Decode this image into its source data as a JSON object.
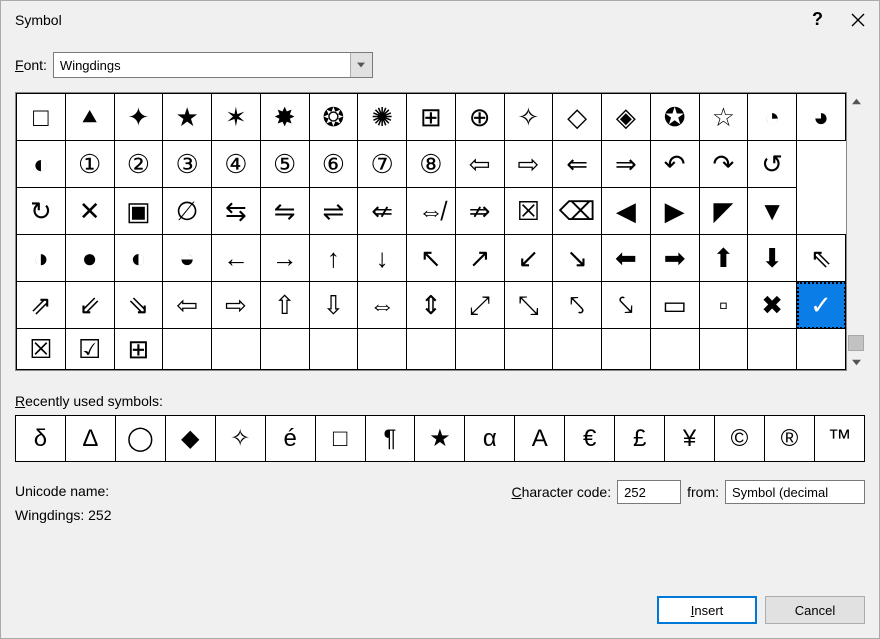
{
  "dialog": {
    "title": "Symbol"
  },
  "font": {
    "label_prefix": "F",
    "label_rest": "ont:",
    "value": "Wingdings"
  },
  "grid": {
    "rows": [
      [
        "□",
        "⯅",
        "✦",
        "★",
        "✶",
        "✸",
        "❂",
        "✺",
        "⊞",
        "⊕",
        "✧",
        "◇",
        "◈",
        "✪",
        "☆",
        "◔",
        "◕"
      ],
      [
        "◐",
        "①",
        "②",
        "③",
        "④",
        "⑤",
        "⑥",
        "⑦",
        "⑧",
        "⇦",
        "⇨",
        "⇐",
        "⇒",
        "↶",
        "↷",
        "↺"
      ],
      [
        "↻",
        "✕",
        "▣",
        "∅",
        "⇆",
        "⇋",
        "⇌",
        "⇍",
        "⇎",
        "⇏",
        "☒",
        "⌫",
        "◀",
        "▶",
        "◤",
        "▼"
      ],
      [
        "◑",
        "●",
        "◐",
        "◒",
        "←",
        "→",
        "↑",
        "↓",
        "↖",
        "↗",
        "↙",
        "↘",
        "⬅",
        "➡",
        "⬆",
        "⬇",
        "⇖"
      ],
      [
        "⇗",
        "⇙",
        "⇘",
        "⇦",
        "⇨",
        "⇧",
        "⇩",
        "⇔",
        "⇕",
        "⤢",
        "⤡",
        "⤣",
        "⤥",
        "▭",
        "▫",
        "✖",
        "✓"
      ],
      [
        "☒",
        "☑",
        "⊞",
        "",
        "",
        "",
        "",
        "",
        "",
        "",
        "",
        "",
        "",
        "",
        "",
        "",
        ""
      ]
    ],
    "selected": {
      "row": 4,
      "col": 16
    }
  },
  "recent": {
    "label_prefix": "R",
    "label_rest": "ecently used symbols:",
    "items": [
      "δ",
      "Δ",
      "◯",
      "◆",
      "✧",
      "é",
      "□",
      "¶",
      "★",
      "α",
      "A",
      "€",
      "£",
      "¥",
      "©",
      "®",
      "™"
    ]
  },
  "unicode": {
    "name_label": "Unicode name:",
    "name_value": "Wingdings: 252",
    "code_label_prefix": "C",
    "code_label_rest": "haracter code:",
    "code_value": "252",
    "from_label": "from:",
    "from_value": "Symbol (decimal"
  },
  "buttons": {
    "insert_prefix": "I",
    "insert_rest": "nsert",
    "cancel": "Cancel"
  }
}
